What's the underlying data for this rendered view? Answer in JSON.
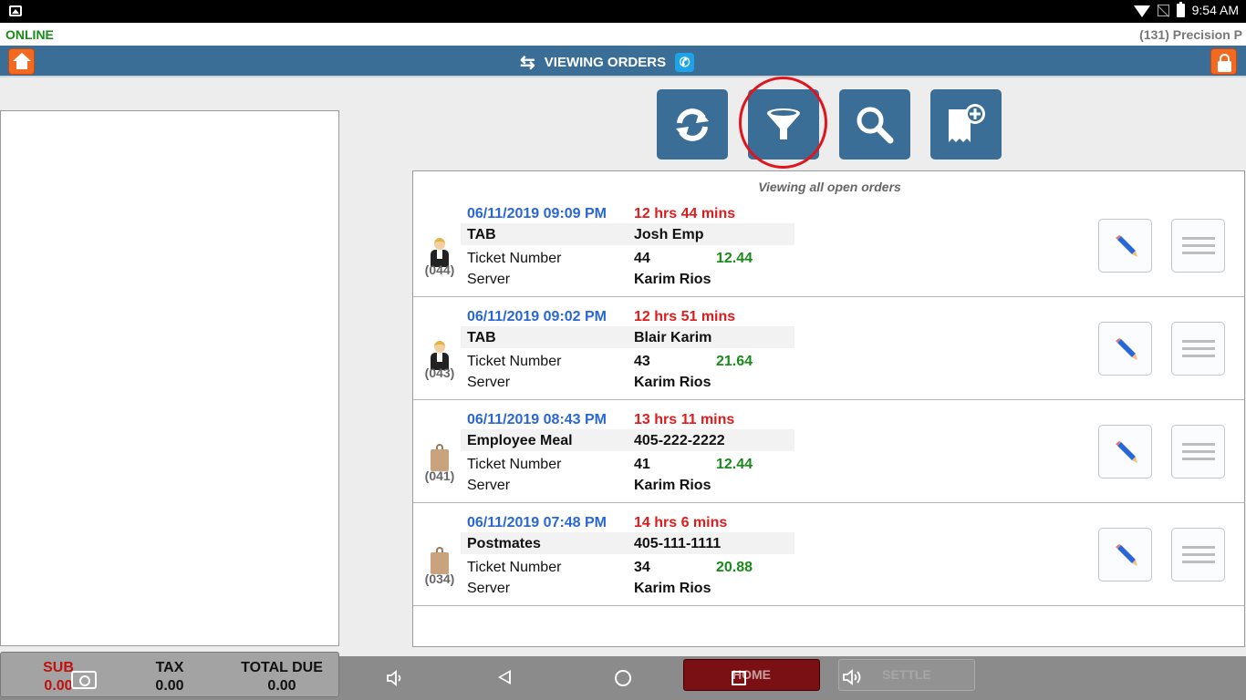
{
  "status_bar": {
    "time": "9:54 AM"
  },
  "top": {
    "connection": "ONLINE",
    "store": "(131) Precision P"
  },
  "header": {
    "title": "VIEWING ORDERS"
  },
  "orders": {
    "caption": "Viewing all open orders",
    "labels": {
      "ticket": "Ticket Number",
      "server": "Server"
    },
    "items": [
      {
        "num": "(044)",
        "icon": "waiter-icon",
        "date": "06/11/2019 09:09 PM",
        "elapsed": "12 hrs 44 mins",
        "type": "TAB",
        "name": "Josh Emp",
        "ticket": "44",
        "amount": "12.44",
        "server": "Karim Rios"
      },
      {
        "num": "(043)",
        "icon": "waiter-icon",
        "date": "06/11/2019 09:02 PM",
        "elapsed": "12 hrs 51 mins",
        "type": "TAB",
        "name": "Blair Karim",
        "ticket": "43",
        "amount": "21.64",
        "server": "Karim Rios"
      },
      {
        "num": "(041)",
        "icon": "bag-icon",
        "date": "06/11/2019 08:43 PM",
        "elapsed": "13 hrs 11 mins",
        "type": "Employee Meal",
        "name": "405-222-2222",
        "ticket": "41",
        "amount": "12.44",
        "server": "Karim Rios"
      },
      {
        "num": "(034)",
        "icon": "bag-icon",
        "date": "06/11/2019 07:48 PM",
        "elapsed": "14 hrs 6 mins",
        "type": "Postmates",
        "name": "405-111-1111",
        "ticket": "34",
        "amount": "20.88",
        "server": "Karim Rios"
      }
    ]
  },
  "totals": {
    "sub_label": "SUB",
    "sub_value": "0.00",
    "tax_label": "TAX",
    "tax_value": "0.00",
    "due_label": "TOTAL DUE",
    "due_value": "0.00"
  },
  "bottom": {
    "home_label": "HOME",
    "settle_label": "SETTLE"
  },
  "colors": {
    "header": "#3a6e96",
    "accent_orange": "#f26a22",
    "date_blue": "#2a67d6",
    "elapsed_red": "#e01b1b",
    "amount_green": "#1a8a1a",
    "home_button": "#7a0f14"
  }
}
